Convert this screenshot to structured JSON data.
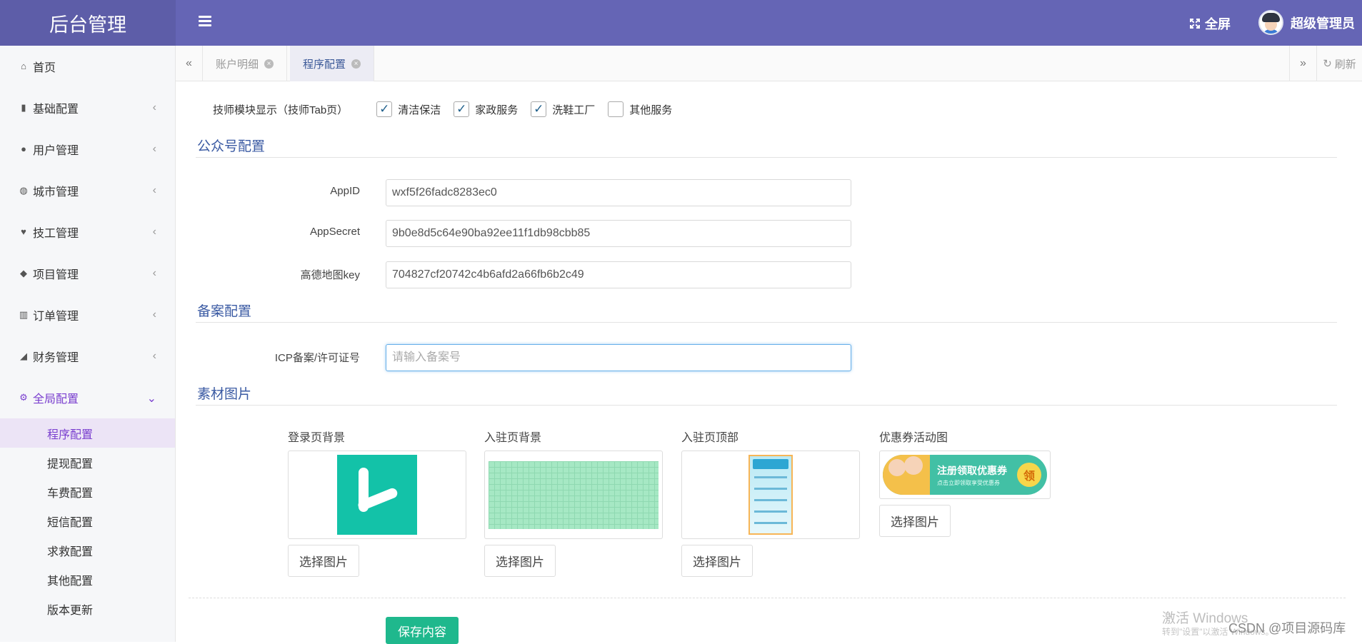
{
  "app": {
    "title": "后台管理",
    "fullscreen_label": "全屏",
    "user_name": "超级管理员"
  },
  "sidebar": {
    "items": [
      {
        "label": "首页",
        "icon": "home-icon",
        "has_chevron": false
      },
      {
        "label": "基础配置",
        "icon": "bookmark-icon",
        "has_chevron": true
      },
      {
        "label": "用户管理",
        "icon": "user-icon",
        "has_chevron": true
      },
      {
        "label": "城市管理",
        "icon": "globe-icon",
        "has_chevron": true
      },
      {
        "label": "技工管理",
        "icon": "heart-icon",
        "has_chevron": true
      },
      {
        "label": "项目管理",
        "icon": "tag-icon",
        "has_chevron": true
      },
      {
        "label": "订单管理",
        "icon": "bar-chart-icon",
        "has_chevron": true
      },
      {
        "label": "财务管理",
        "icon": "area-chart-icon",
        "has_chevron": true
      },
      {
        "label": "全局配置",
        "icon": "gears-icon",
        "has_chevron": true,
        "expanded": true
      }
    ],
    "submenu": [
      "程序配置",
      "提现配置",
      "车费配置",
      "短信配置",
      "求救配置",
      "其他配置",
      "版本更新"
    ],
    "current_submenu": "程序配置"
  },
  "tabs": {
    "items": [
      {
        "label": "账户明细",
        "active": false
      },
      {
        "label": "程序配置",
        "active": true
      }
    ],
    "refresh_label": "刷新"
  },
  "form": {
    "tech_module": {
      "label": "技师模块显示（技师Tab页）",
      "options": [
        {
          "label": "清洁保洁",
          "checked": true
        },
        {
          "label": "家政服务",
          "checked": true
        },
        {
          "label": "洗鞋工厂",
          "checked": true
        },
        {
          "label": "其他服务",
          "checked": false
        }
      ]
    },
    "wechat_section": "公众号配置",
    "appid_label": "AppID",
    "appid_value": "wxf5f26fadc8283ec0",
    "appsecret_label": "AppSecret",
    "appsecret_value": "9b0e8d5c64e90ba92ee11f1db98cbb85",
    "amap_label": "高德地图key",
    "amap_value": "704827cf20742c4b6afd2a66fb6b2c49",
    "icp_section": "备案配置",
    "icp_label": "ICP备案/许可证号",
    "icp_placeholder": "请输入备案号",
    "material_section": "素材图片",
    "images": [
      {
        "label": "登录页背景",
        "button": "选择图片"
      },
      {
        "label": "入驻页背景",
        "button": "选择图片"
      },
      {
        "label": "入驻页顶部",
        "button": "选择图片"
      },
      {
        "label": "优惠券活动图",
        "button": "选择图片"
      }
    ],
    "coupon_text": "注册领取优惠券",
    "coupon_sub": "点击立即领取享受优惠券",
    "coupon_badge": "领",
    "save_label": "保存内容"
  },
  "overlay": {
    "windows_activate": "激活 Windows",
    "windows_hint": "转到\"设置\"以激活 Windows。",
    "csdn": "CSDN @项目源码库"
  },
  "colors": {
    "header": "#6565b5",
    "brand_bg": "#5d5da8",
    "accent_purple": "#7a3fcf",
    "save_green": "#1fb88d",
    "section_blue": "#3a5aa3"
  }
}
